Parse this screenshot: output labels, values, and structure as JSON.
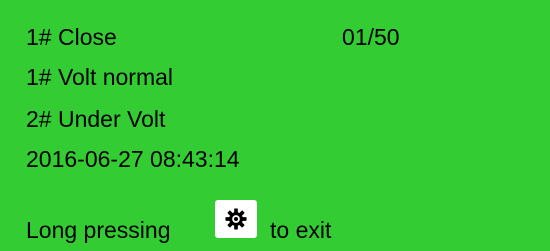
{
  "screen": {
    "background_color": "#33cc33",
    "text_color": "#000000",
    "line1": "1# Close",
    "counter": "01/50",
    "line2": "1# Volt normal",
    "line3": "2# Under Volt",
    "timestamp": "2016-06-27 08:43:14",
    "exit_prefix": "Long pressing",
    "exit_icon": "gear-icon",
    "exit_suffix": "to exit"
  }
}
